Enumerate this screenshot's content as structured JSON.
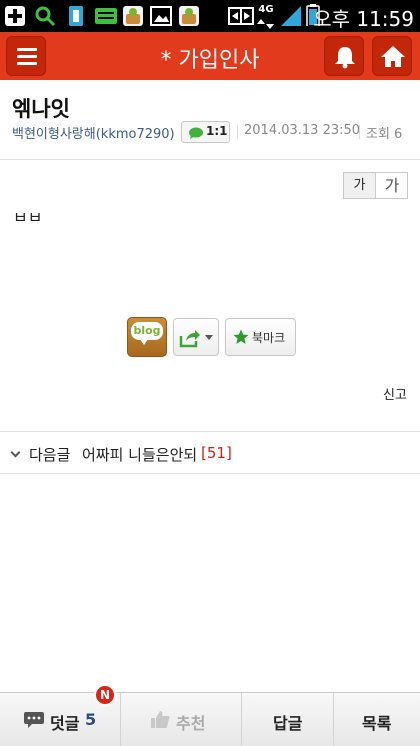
{
  "status_bar": {
    "time": "오후 11:59",
    "network": "4G"
  },
  "header": {
    "title": "* 가입인사"
  },
  "post": {
    "title": "엒나잇",
    "author": "백현이형사랑해(kkmo7290)",
    "chat_label": "1:1",
    "date": "2014.03.13 23:50",
    "views": "조회 6",
    "font_small": "가",
    "font_large": "가",
    "body": "ㅂㅂ"
  },
  "actions": {
    "blog_label": "blog",
    "bookmark_label": "북마크",
    "report_label": "신고"
  },
  "next_post": {
    "label": "다음글",
    "title": "어짜피 니들은안되",
    "comment_count": "[51]"
  },
  "bottom_bar": {
    "comments_label": "덧글",
    "comments_count": "5",
    "new_badge": "N",
    "recommend_label": "추천",
    "reply_label": "답글",
    "list_label": "목록"
  },
  "colors": {
    "header_bg": "#e23a1c",
    "header_btn": "#c4260a",
    "author_link": "#3a5b8c",
    "count_red": "#d0231b",
    "comments_count": "#2a4a86"
  }
}
